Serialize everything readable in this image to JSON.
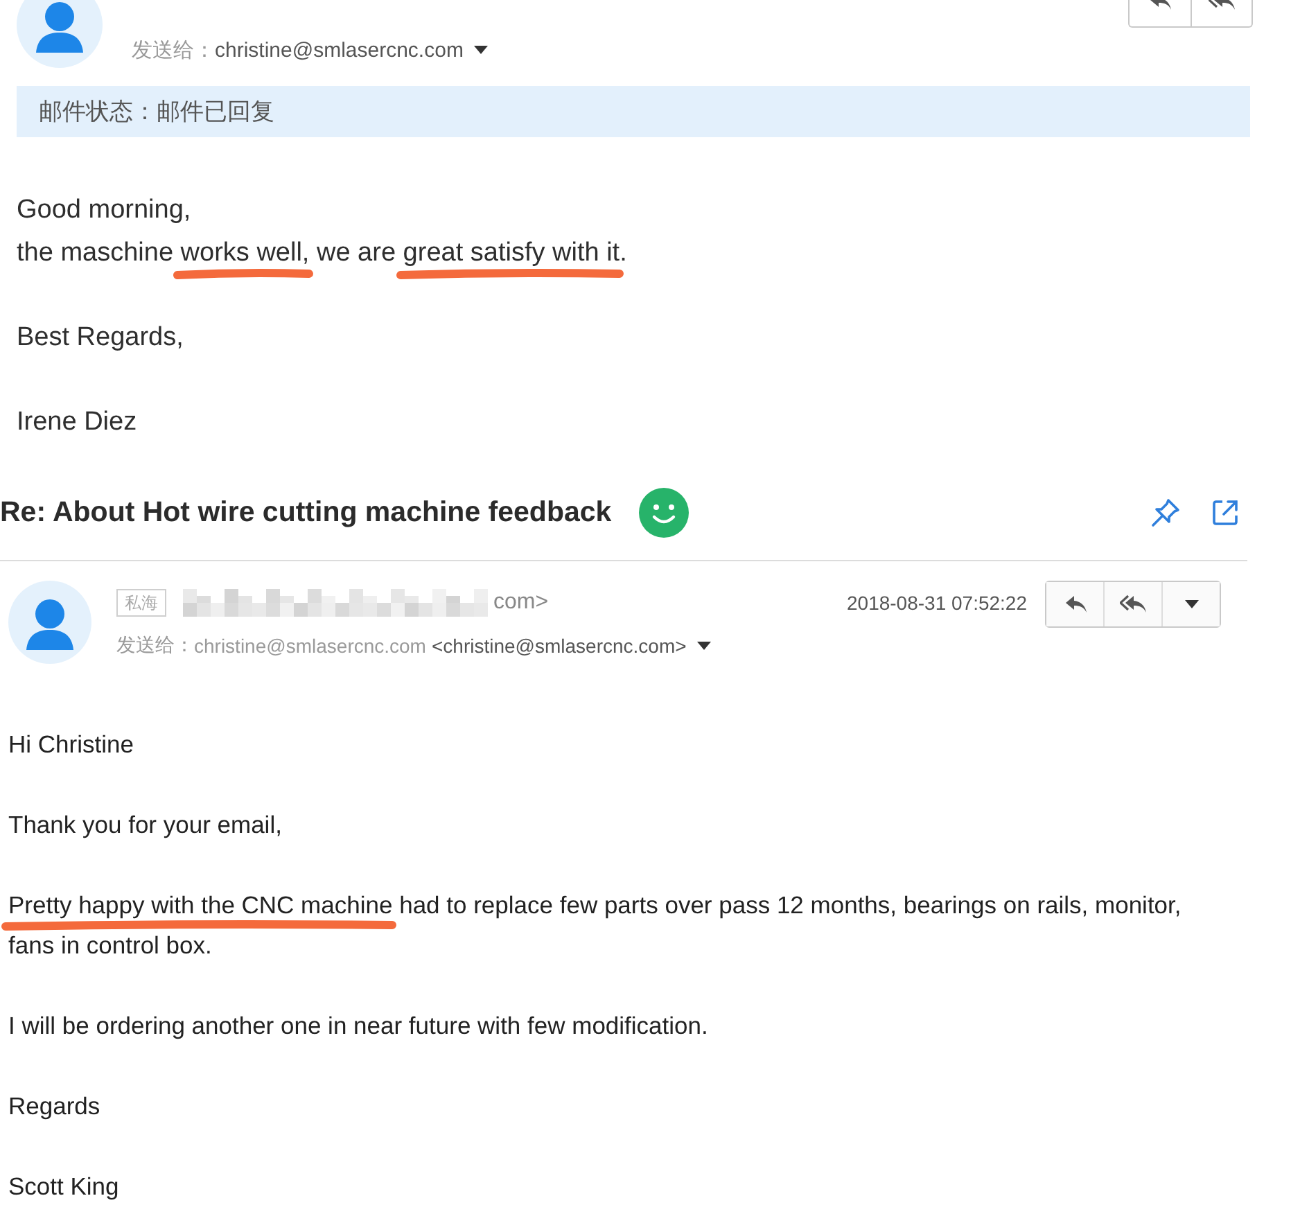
{
  "emails": [
    {
      "kind": "partial",
      "recipients_label": "发送给：",
      "recipient_address": "christine@smlasercnc.com",
      "status": "邮件状态：邮件已回复",
      "body": [
        {
          "lines": [
            {
              "segments": [
                {
                  "text": "Good morning,",
                  "marked": false
                }
              ]
            },
            {
              "segments": [
                {
                  "text": "the maschine ",
                  "marked": false
                },
                {
                  "text": "works well,",
                  "marked": true
                },
                {
                  "text": " we are ",
                  "marked": false
                },
                {
                  "text": "great satisfy with it",
                  "marked": true
                },
                {
                  "text": ".",
                  "marked": false
                }
              ]
            }
          ]
        },
        {
          "lines": [
            {
              "segments": [
                {
                  "text": "Best Regards,",
                  "marked": false
                }
              ]
            }
          ]
        },
        {
          "lines": [
            {
              "segments": [
                {
                  "text": "Irene Diez",
                  "marked": false
                }
              ]
            }
          ]
        }
      ]
    },
    {
      "kind": "full",
      "subject": "Re: About Hot wire cutting machine feedback",
      "tag": "私海",
      "sender_visible": "com>",
      "date": "2018-08-31 07:52:22",
      "recipients_label": "发送给：",
      "recipient_name": "christine@smlasercnc.com",
      "recipient_address": "<christine@smlasercnc.com>",
      "body": [
        {
          "lines": [
            {
              "segments": [
                {
                  "text": "Hi Christine",
                  "marked": false
                }
              ]
            }
          ]
        },
        {
          "lines": [
            {
              "segments": [
                {
                  "text": "Thank you for your email,",
                  "marked": false
                }
              ]
            }
          ]
        },
        {
          "lines": [
            {
              "segments": [
                {
                  "text": "Pretty happy with the CNC machine",
                  "marked": true
                },
                {
                  "text": " had to replace few parts over pass 12 months, bearings on rails, monitor, fans in control box.",
                  "marked": false
                }
              ]
            }
          ]
        },
        {
          "lines": [
            {
              "segments": [
                {
                  "text": "I will be ordering another one in near future with few modification.",
                  "marked": false
                }
              ]
            }
          ]
        },
        {
          "lines": [
            {
              "segments": [
                {
                  "text": "Regards",
                  "marked": false
                }
              ]
            }
          ]
        },
        {
          "lines": [
            {
              "segments": [
                {
                  "text": "Scott King",
                  "marked": false
                }
              ]
            }
          ]
        }
      ]
    }
  ]
}
